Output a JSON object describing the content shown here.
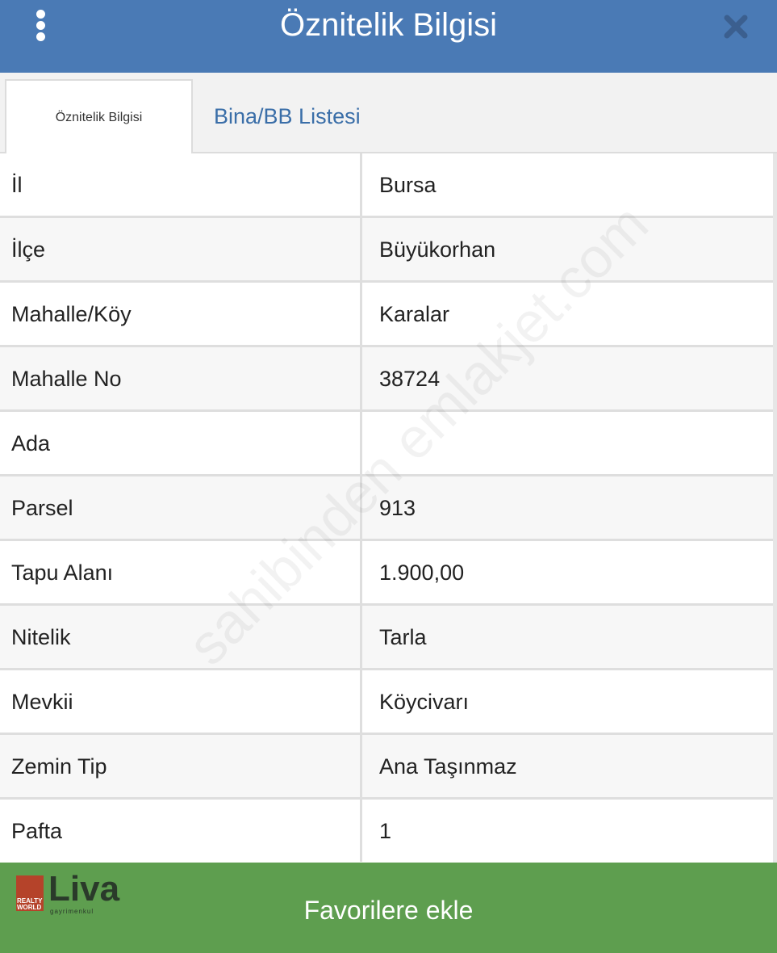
{
  "header": {
    "title": "Öznitelik Bilgisi",
    "menu_icon": "vertical-dots-icon",
    "close_icon": "close-icon"
  },
  "tabs": [
    {
      "label": "Öznitelik Bilgisi",
      "active": true
    },
    {
      "label": "Bina/BB Listesi",
      "active": false
    }
  ],
  "rows": [
    {
      "label": "İl",
      "value": "Bursa"
    },
    {
      "label": "İlçe",
      "value": "Büyükorhan"
    },
    {
      "label": "Mahalle/Köy",
      "value": "Karalar"
    },
    {
      "label": "Mahalle No",
      "value": "38724"
    },
    {
      "label": "Ada",
      "value": ""
    },
    {
      "label": "Parsel",
      "value": "913"
    },
    {
      "label": "Tapu Alanı",
      "value": "1.900,00"
    },
    {
      "label": "Nitelik",
      "value": "Tarla"
    },
    {
      "label": "Mevkii",
      "value": "Köycivarı"
    },
    {
      "label": "Zemin Tip",
      "value": "Ana Taşınmaz"
    },
    {
      "label": "Pafta",
      "value": "1"
    }
  ],
  "watermark": "sahibinden emlakjet.com",
  "footer": {
    "button_label": "Favorilere ekle",
    "logo": {
      "brand": "Liva",
      "badge": "REALTY WORLD",
      "sub": "gayrimenkul"
    }
  },
  "colors": {
    "header_bg": "#4a7ab5",
    "tab_link": "#3a6ea8",
    "footer_bg": "#5e9e4f",
    "logo_red": "#b5432a"
  }
}
